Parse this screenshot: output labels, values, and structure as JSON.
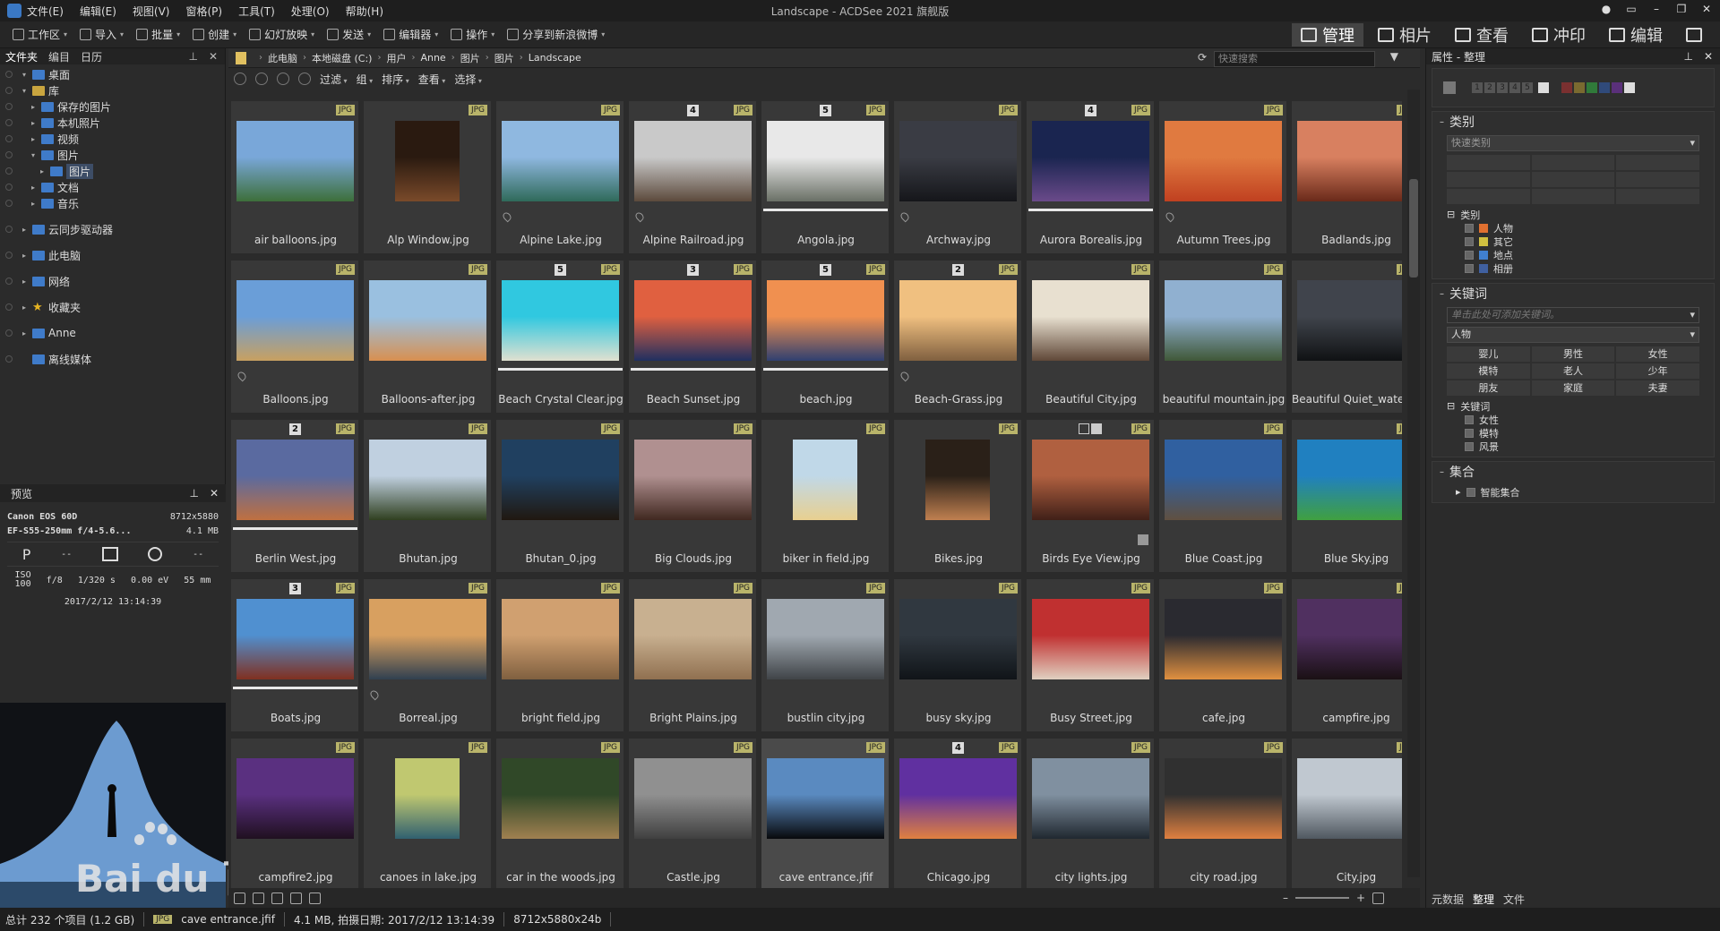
{
  "title": "Landscape - ACDSee 2021 旗舰版",
  "menu": [
    "文件(E)",
    "编辑(E)",
    "视图(V)",
    "窗格(P)",
    "工具(T)",
    "处理(O)",
    "帮助(H)"
  ],
  "toolbar": [
    {
      "label": "工作区",
      "icon": "workspace-icon"
    },
    {
      "label": "导入",
      "icon": "import-icon"
    },
    {
      "label": "批量",
      "icon": "batch-icon"
    },
    {
      "label": "创建",
      "icon": "create-icon"
    },
    {
      "label": "幻灯放映",
      "icon": "slideshow-icon"
    },
    {
      "label": "发送",
      "icon": "send-icon"
    },
    {
      "label": "编辑器",
      "icon": "editor-icon"
    },
    {
      "label": "操作",
      "icon": "action-icon"
    },
    {
      "label": "分享到新浪微博",
      "icon": "share-icon"
    }
  ],
  "modes": [
    "管理",
    "相片",
    "查看",
    "冲印",
    "编辑"
  ],
  "left": {
    "tabs": [
      "文件夹",
      "编目",
      "日历"
    ],
    "tree": [
      {
        "label": "桌面",
        "depth": 1,
        "exp": "▾",
        "ico": "blue"
      },
      {
        "label": "库",
        "depth": 1,
        "exp": "▾",
        "ico": "yellow"
      },
      {
        "label": "保存的图片",
        "depth": 2,
        "exp": "▸",
        "ico": "blue"
      },
      {
        "label": "本机照片",
        "depth": 2,
        "exp": "▸",
        "ico": "blue"
      },
      {
        "label": "视频",
        "depth": 2,
        "exp": "▸",
        "ico": "blue"
      },
      {
        "label": "图片",
        "depth": 2,
        "exp": "▾",
        "ico": "blue"
      },
      {
        "label": "图片",
        "depth": 3,
        "exp": "▸",
        "ico": "blue",
        "sel": true
      },
      {
        "label": "文档",
        "depth": 2,
        "exp": "▸",
        "ico": "blue"
      },
      {
        "label": "音乐",
        "depth": 2,
        "exp": "▸",
        "ico": "blue"
      },
      {
        "label": "",
        "depth": 0
      },
      {
        "label": "云同步驱动器",
        "depth": 1,
        "exp": "▸",
        "ico": "blue"
      },
      {
        "label": "",
        "depth": 0
      },
      {
        "label": "此电脑",
        "depth": 1,
        "exp": "▸",
        "ico": "blue"
      },
      {
        "label": "",
        "depth": 0
      },
      {
        "label": "网络",
        "depth": 1,
        "exp": "▸",
        "ico": "blue"
      },
      {
        "label": "",
        "depth": 0
      },
      {
        "label": "收藏夹",
        "depth": 1,
        "exp": "▸",
        "ico": "star"
      },
      {
        "label": "",
        "depth": 0
      },
      {
        "label": "Anne",
        "depth": 1,
        "exp": "▸",
        "ico": "blue"
      },
      {
        "label": "",
        "depth": 0
      },
      {
        "label": "离线媒体",
        "depth": 1,
        "exp": "",
        "ico": "blue"
      }
    ]
  },
  "preview": {
    "title": "预览",
    "camera": "Canon EOS 60D",
    "dims": "8712x5880",
    "lens": "EF-S55-250mm f/4-5.6...",
    "size": "4.1 MB",
    "mode": "P",
    "dash1": "--",
    "dash2": "--",
    "iso_label": "ISO",
    "iso": "100",
    "fnum": "f/8",
    "shutter": "1/320 s",
    "ev": "0.00 eV",
    "focal": "55 mm",
    "date": "2017/2/12 13:14:39"
  },
  "path": [
    "此电脑",
    "本地磁盘 (C:)",
    "用户",
    "Anne",
    "图片",
    "图片",
    "Landscape"
  ],
  "search_placeholder": "快速搜索",
  "filterbar": [
    "过滤",
    "组",
    "排序",
    "查看",
    "选择"
  ],
  "thumbs": [
    {
      "name": "air balloons.jpg",
      "c1": "#79a7d9",
      "c2": "#3d6f3a",
      "pin": false
    },
    {
      "name": "Alp Window.jpg",
      "c1": "#2a1a10",
      "c2": "#7a4a2a",
      "portrait": true
    },
    {
      "name": "Alpine Lake.jpg",
      "c1": "#8fb8e0",
      "c2": "#2f6a5a",
      "pin": true
    },
    {
      "name": "Alpine Railroad.jpg",
      "c1": "#c9c9c9",
      "c2": "#5c4a3c",
      "num": "4",
      "pin": true
    },
    {
      "name": "Angola.jpg",
      "c1": "#e8e8e8",
      "c2": "#6a7066",
      "num": "5",
      "bar": true
    },
    {
      "name": "Archway.jpg",
      "c1": "#3a3c44",
      "c2": "#15161a",
      "pin": true
    },
    {
      "name": "Aurora Borealis.jpg",
      "c1": "#1a2550",
      "c2": "#6a4a8a",
      "num": "4",
      "bar": true
    },
    {
      "name": "Autumn Trees.jpg",
      "c1": "#e07a40",
      "c2": "#c04020",
      "pin": true
    },
    {
      "name": "Badlands.jpg",
      "c1": "#d88060",
      "c2": "#6a2a1a"
    },
    {
      "name": "Balloons.jpg",
      "c1": "#6a9ed8",
      "c2": "#c8a060",
      "pin": true
    },
    {
      "name": "Balloons-after.jpg",
      "c1": "#9ac0e0",
      "c2": "#d89050"
    },
    {
      "name": "Beach Crystal Clear.jpg",
      "c1": "#30c8e0",
      "c2": "#e0e0d0",
      "num": "5",
      "bar": true
    },
    {
      "name": "Beach Sunset.jpg",
      "c1": "#e06040",
      "c2": "#203060",
      "num": "3",
      "bar": true
    },
    {
      "name": "beach.jpg",
      "c1": "#f09050",
      "c2": "#304070",
      "num": "5",
      "bar": true
    },
    {
      "name": "Beach-Grass.jpg",
      "c1": "#f0c080",
      "c2": "#806040",
      "num": "2",
      "pin": true
    },
    {
      "name": "Beautiful City.jpg",
      "c1": "#e8e0d0",
      "c2": "#604838"
    },
    {
      "name": "beautiful mountain.jpg",
      "c1": "#90b0d0",
      "c2": "#405838"
    },
    {
      "name": "Beautiful Quiet_waterm...",
      "c1": "#40444c",
      "c2": "#101214"
    },
    {
      "name": "Berlin West.jpg",
      "c1": "#5a6aa0",
      "c2": "#c07040",
      "num": "2",
      "bar": true
    },
    {
      "name": "Bhutan.jpg",
      "c1": "#c0d0e0",
      "c2": "#304020"
    },
    {
      "name": "Bhutan_0.jpg",
      "c1": "#204060",
      "c2": "#201810"
    },
    {
      "name": "Big Clouds.jpg",
      "c1": "#b09090",
      "c2": "#402820"
    },
    {
      "name": "biker in field.jpg",
      "c1": "#c0d8e8",
      "c2": "#e8d090",
      "portrait": true
    },
    {
      "name": "Bikes.jpg",
      "c1": "#2a2018",
      "c2": "#c08050",
      "portrait": true
    },
    {
      "name": "Birds Eye View.jpg",
      "c1": "#b06040",
      "c2": "#402018",
      "checks": true
    },
    {
      "name": "Blue Coast.jpg",
      "c1": "#3060a0",
      "c2": "#605040"
    },
    {
      "name": "Blue Sky.jpg",
      "c1": "#2080c0",
      "c2": "#40a040"
    },
    {
      "name": "Boats.jpg",
      "c1": "#5090d0",
      "c2": "#803020",
      "num": "3",
      "bar": true
    },
    {
      "name": "Borreal.jpg",
      "c1": "#d8a060",
      "c2": "#304050",
      "pin": true
    },
    {
      "name": "bright field.jpg",
      "c1": "#d0a070",
      "c2": "#806040"
    },
    {
      "name": "Bright Plains.jpg",
      "c1": "#c8b090",
      "c2": "#907050"
    },
    {
      "name": "bustlin city.jpg",
      "c1": "#a0a8b0",
      "c2": "#404448"
    },
    {
      "name": "busy sky.jpg",
      "c1": "#303840",
      "c2": "#101418"
    },
    {
      "name": "Busy Street.jpg",
      "c1": "#c03030",
      "c2": "#e0d0c0"
    },
    {
      "name": "cafe.jpg",
      "c1": "#2a2a30",
      "c2": "#e09040"
    },
    {
      "name": "campfire.jpg",
      "c1": "#503060",
      "c2": "#1a1014"
    },
    {
      "name": "campfire2.jpg",
      "c1": "#5a3080",
      "c2": "#201020"
    },
    {
      "name": "canoes in lake.jpg",
      "c1": "#c0c870",
      "c2": "#306070",
      "portrait": true
    },
    {
      "name": "car in the woods.jpg",
      "c1": "#304828",
      "c2": "#a08050"
    },
    {
      "name": "Castle.jpg",
      "c1": "#909090",
      "c2": "#404040"
    },
    {
      "name": "cave entrance.jfif",
      "c1": "#5a8ac0",
      "c2": "#08090c",
      "selected": true
    },
    {
      "name": "Chicago.jpg",
      "c1": "#6030a0",
      "c2": "#e08040",
      "num": "4"
    },
    {
      "name": "city lights.jpg",
      "c1": "#8090a0",
      "c2": "#202830"
    },
    {
      "name": "city road.jpg",
      "c1": "#303030",
      "c2": "#e08040"
    },
    {
      "name": "City.jpg",
      "c1": "#c0c8d0",
      "c2": "#505860"
    }
  ],
  "right": {
    "title": "属性 - 整理",
    "ratings": [
      "1",
      "2",
      "3",
      "4",
      "5"
    ],
    "category": {
      "title": "类别",
      "dd": "快速类别",
      "tree_title": "类别",
      "items": [
        "人物",
        "其它",
        "地点",
        "相册"
      ]
    },
    "keywords": {
      "title": "关键词",
      "placeholder": "单击此处可添加关键词。",
      "dd": "人物",
      "grid": [
        "婴儿",
        "男性",
        "女性",
        "模特",
        "老人",
        "少年",
        "朋友",
        "家庭",
        "夫妻"
      ],
      "tree_title": "关键词",
      "items": [
        "女性",
        "模特",
        "风景"
      ]
    },
    "collections": {
      "title": "集合",
      "item": "智能集合"
    },
    "tabs": [
      "元数据",
      "整理",
      "文件"
    ]
  },
  "status": {
    "total": "总计 232 个项目 (1.2 GB)",
    "type": "JPG",
    "file": "cave entrance.jfif",
    "info": "4.1 MB, 拍摄日期: 2017/2/12 13:14:39",
    "dims": "8712x5880x24b"
  }
}
